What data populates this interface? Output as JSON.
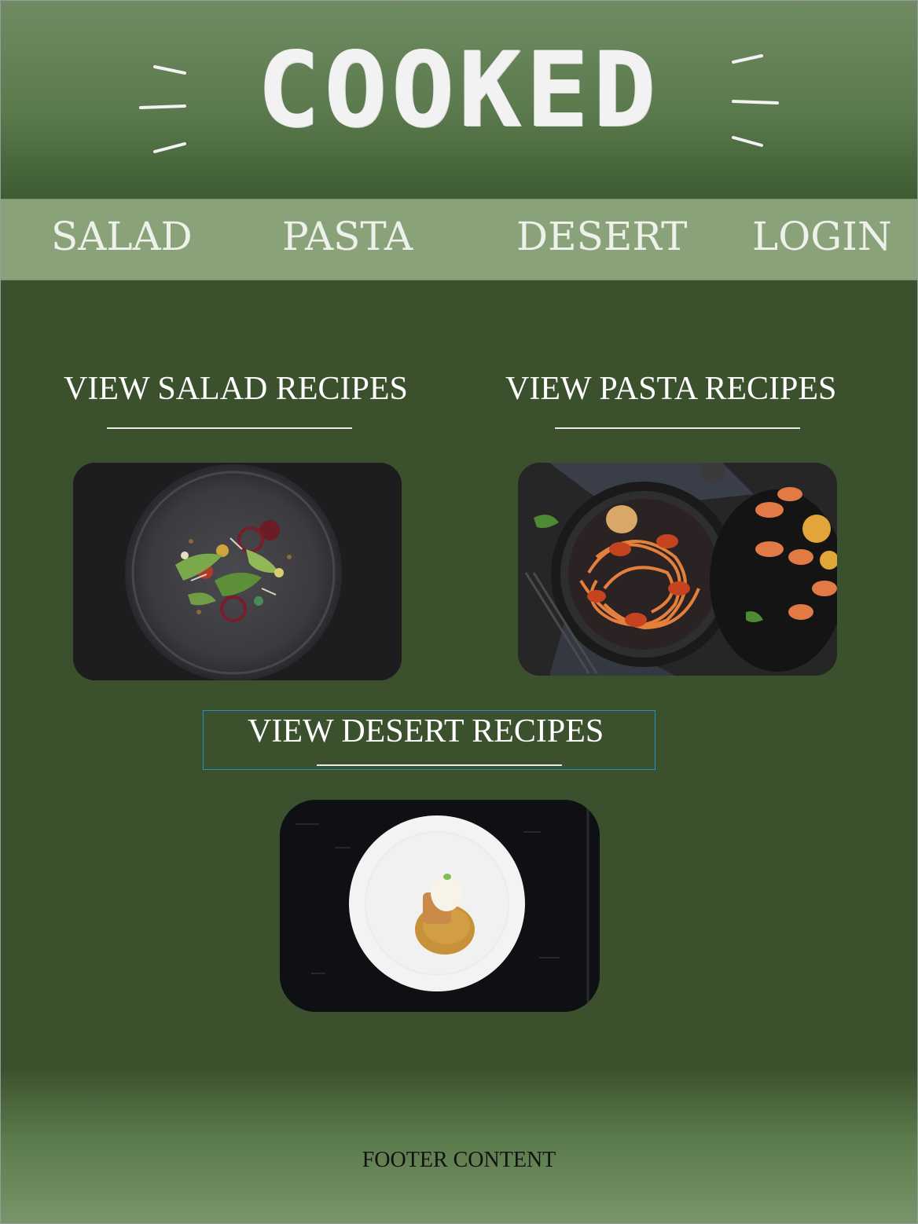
{
  "header": {
    "logo_text": "COOKED"
  },
  "nav": {
    "items": [
      {
        "label": "SALAD"
      },
      {
        "label": "PASTA"
      },
      {
        "label": "DESERT"
      },
      {
        "label": "LOGIN"
      }
    ]
  },
  "main": {
    "salad": {
      "title": "VIEW SALAD RECIPES"
    },
    "pasta": {
      "title": "VIEW PASTA RECIPES"
    },
    "desert": {
      "title": "VIEW DESERT RECIPES"
    }
  },
  "footer": {
    "text": "FOOTER CONTENT"
  },
  "colors": {
    "header_green": "#5b7a4d",
    "nav_green": "#89a27a",
    "body_green": "#3b502d",
    "selection_blue": "#2a8bd0"
  }
}
